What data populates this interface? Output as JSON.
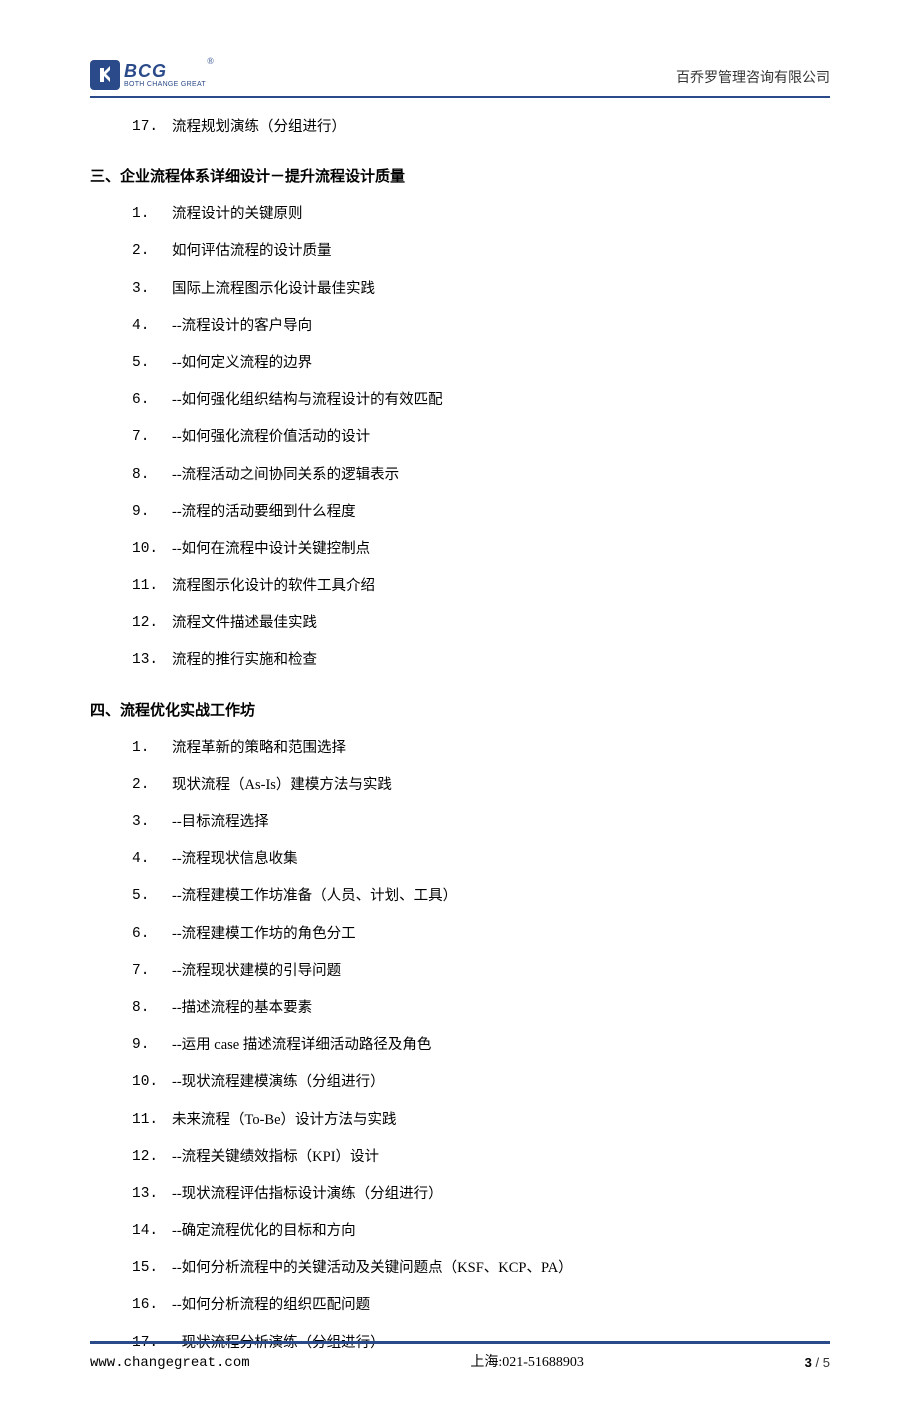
{
  "header": {
    "logo_main": "BCG",
    "logo_tag": "BOTH CHANGE GREAT",
    "reg_mark": "®",
    "company": "百乔罗管理咨询有限公司"
  },
  "prev_section": {
    "start": 17,
    "items": [
      "流程规划演练（分组进行）"
    ]
  },
  "sections": [
    {
      "title": "三、企业流程体系详细设计－提升流程设计质量",
      "items": [
        "流程设计的关键原则",
        "如何评估流程的设计质量",
        "国际上流程图示化设计最佳实践",
        "--流程设计的客户导向",
        "--如何定义流程的边界",
        "--如何强化组织结构与流程设计的有效匹配",
        "--如何强化流程价值活动的设计",
        "--流程活动之间协同关系的逻辑表示",
        "--流程的活动要细到什么程度",
        "--如何在流程中设计关键控制点",
        "流程图示化设计的软件工具介绍",
        "流程文件描述最佳实践",
        "流程的推行实施和检查"
      ]
    },
    {
      "title": "四、流程优化实战工作坊",
      "items": [
        "流程革新的策略和范围选择",
        "现状流程（As-Is）建模方法与实践",
        "--目标流程选择",
        "--流程现状信息收集",
        "--流程建模工作坊准备（人员、计划、工具）",
        "--流程建模工作坊的角色分工",
        "--流程现状建模的引导问题",
        "--描述流程的基本要素",
        "--运用 case 描述流程详细活动路径及角色",
        "--现状流程建模演练（分组进行）",
        "未来流程（To-Be）设计方法与实践",
        "--流程关键绩效指标（KPI）设计",
        "--现状流程评估指标设计演练（分组进行）",
        "--确定流程优化的目标和方向",
        "--如何分析流程中的关键活动及关键问题点（KSF、KCP、PA）",
        "--如何分析流程的组织匹配问题",
        "--现状流程分析演练（分组进行）"
      ]
    }
  ],
  "footer": {
    "url": "www.changegreat.com",
    "phone": "上海:021-51688903",
    "page_current": "3",
    "page_sep": " / ",
    "page_total": "5"
  }
}
